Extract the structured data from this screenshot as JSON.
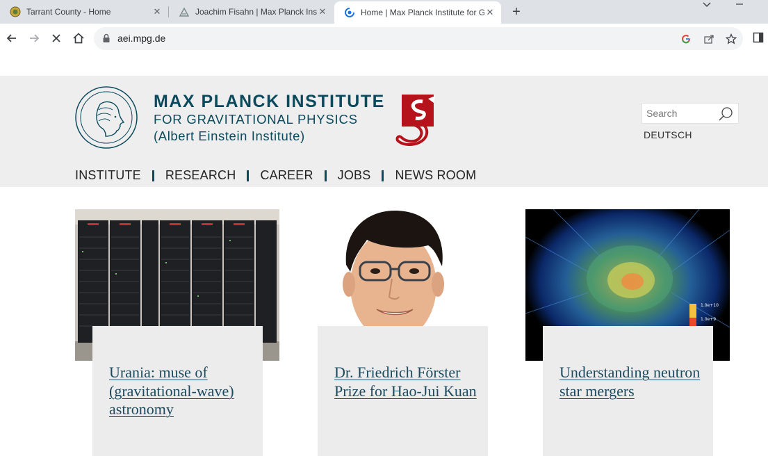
{
  "browser": {
    "tabs": [
      {
        "title": "Tarrant County - Home",
        "active": false,
        "favicon": "county-seal-icon"
      },
      {
        "title": "Joachim Fisahn | Max Planck Insti",
        "active": false,
        "favicon": "mpi-plant-icon"
      },
      {
        "title": "Home | Max Planck Institute for G",
        "active": true,
        "favicon": "loading-spinner-icon"
      }
    ],
    "new_tab": "+",
    "url": "aei.mpg.de"
  },
  "site": {
    "name_line1": "MAX PLANCK INSTITUTE",
    "name_line2": "FOR GRAVITATIONAL PHYSICS",
    "name_line3": "(Albert Einstein Institute)",
    "search_placeholder": "Search",
    "language_link": "DEUTSCH",
    "nav": [
      "INSTITUTE",
      "RESEARCH",
      "CAREER",
      "JOBS",
      "NEWS ROOM"
    ]
  },
  "cards": [
    {
      "title": "Urania: muse of (gravitational-wave) astronomy",
      "image": "supercomputer-racks-photo"
    },
    {
      "title": "Dr. Friedrich Förster Prize for Hao-Jui Kuan",
      "image": "portrait-photo"
    },
    {
      "title": "Understanding neutron star mergers",
      "image": "neutron-star-simulation-image"
    }
  ],
  "colors": {
    "brand": "#0b4a5d",
    "header_bg": "#eeeeee",
    "card_bg": "#ececec",
    "aei_red": "#b5121b"
  }
}
